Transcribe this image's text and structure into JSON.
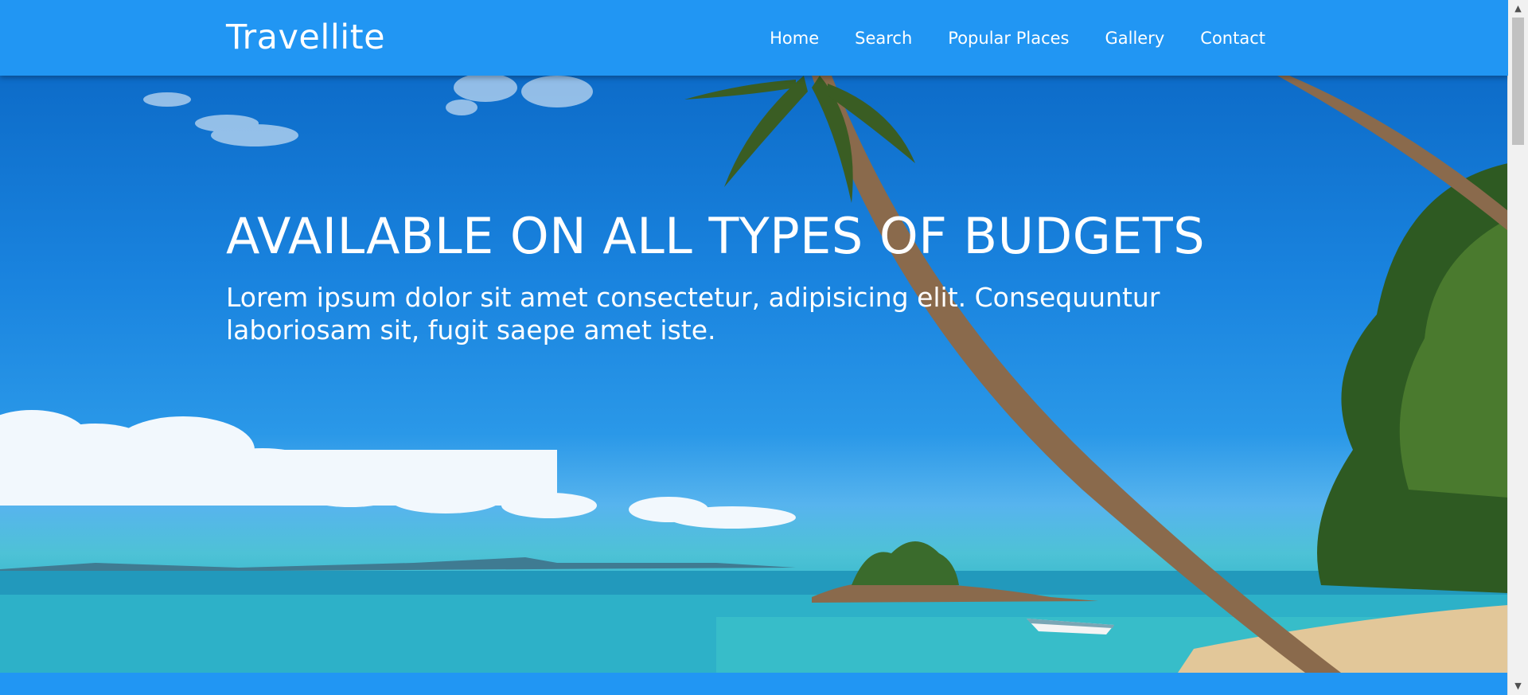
{
  "navbar": {
    "brand": "Travellite",
    "links": [
      "Home",
      "Search",
      "Popular Places",
      "Gallery",
      "Contact"
    ]
  },
  "hero": {
    "title": "AVAILABLE ON ALL TYPES OF BUDGETS",
    "subtitle": "Lorem ipsum dolor sit amet consectetur, adipisicing elit. Consequuntur laboriosam sit, fugit saepe amet iste."
  },
  "scrollbar": {
    "up_arrow": "▲",
    "down_arrow": "▼"
  },
  "colors": {
    "primary": "#2196F3",
    "text": "#ffffff"
  }
}
